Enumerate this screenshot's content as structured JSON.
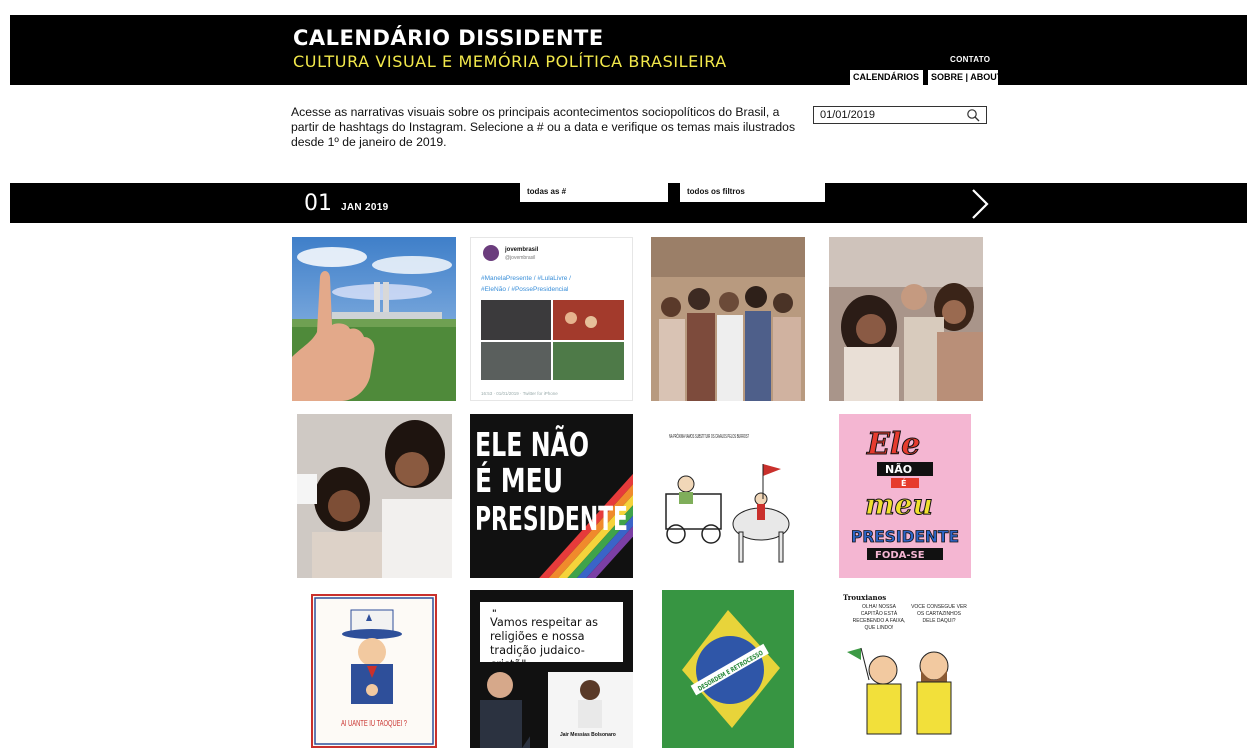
{
  "header": {
    "title": "CALENDÁRIO DISSIDENTE",
    "subtitle": "CULTURA VISUAL E MEMÓRIA POLÍTICA BRASILEIRA",
    "contato": "CONTATO",
    "nav": [
      "CALENDÁRIOS",
      "SOBRE | ABOUT"
    ]
  },
  "intro": {
    "text": "Acesse as narrativas visuais sobre os principais acontecimentos sociopolíticos do Brasil, a partir de hashtags do Instagram. Selecione a # ou a data e verifique os temas mais ilustrados desde 1º de janeiro de 2019."
  },
  "search": {
    "value": "01/01/2019",
    "icon": "search-icon"
  },
  "datebar": {
    "day": "01",
    "month": "JAN 2019",
    "filter_hashtags": "todas as #",
    "filter_all": "todos os filtros",
    "next_icon": "chevron-right-icon"
  },
  "tweet": {
    "name": "jovembrasil",
    "handle": "@jovembrasil",
    "line1": "#ManelaPresente / #LulaLivre /",
    "line2": "#EleNão / #PossePresidencial",
    "footer": "16:53 · 01/01/2019 · Twitter for iPhone"
  },
  "poster_ele_nao": [
    "ELE NÃO",
    "É MEU",
    "PRESIDENTE"
  ],
  "cartoon_carriage": "NA PRÓXIMA VAMOS SUBSTITUIR OS CAVALOS PELOS BURROS?",
  "lettering": {
    "ele": "Ele",
    "nao": "NÃO",
    "e": "É",
    "meu": "meu",
    "presidente": "PRESIDENTE",
    "fodase": "FODA-SE"
  },
  "uncle_sam": "AI UANTE IU TAOQUEI ?",
  "quote": {
    "text": "Vamos respeitar as religiões e nossa tradição judaico-cristã\"",
    "author": "Jair Messias Bolsonaro"
  },
  "flag_motto": "DESORDEM E RETROCESSO",
  "trouxianos": {
    "title": "Trouxianos",
    "left": "OLHA! NOSSA CAPITÃO ESTÁ RECEBENDO A FAIXA, QUE LINDO!",
    "right": "VOCÊ CONSEGUE VER OS CARTAZINHOS DELE DAQUI?"
  },
  "colors": {
    "accent": "#f2e84b",
    "bar": "#000000"
  }
}
